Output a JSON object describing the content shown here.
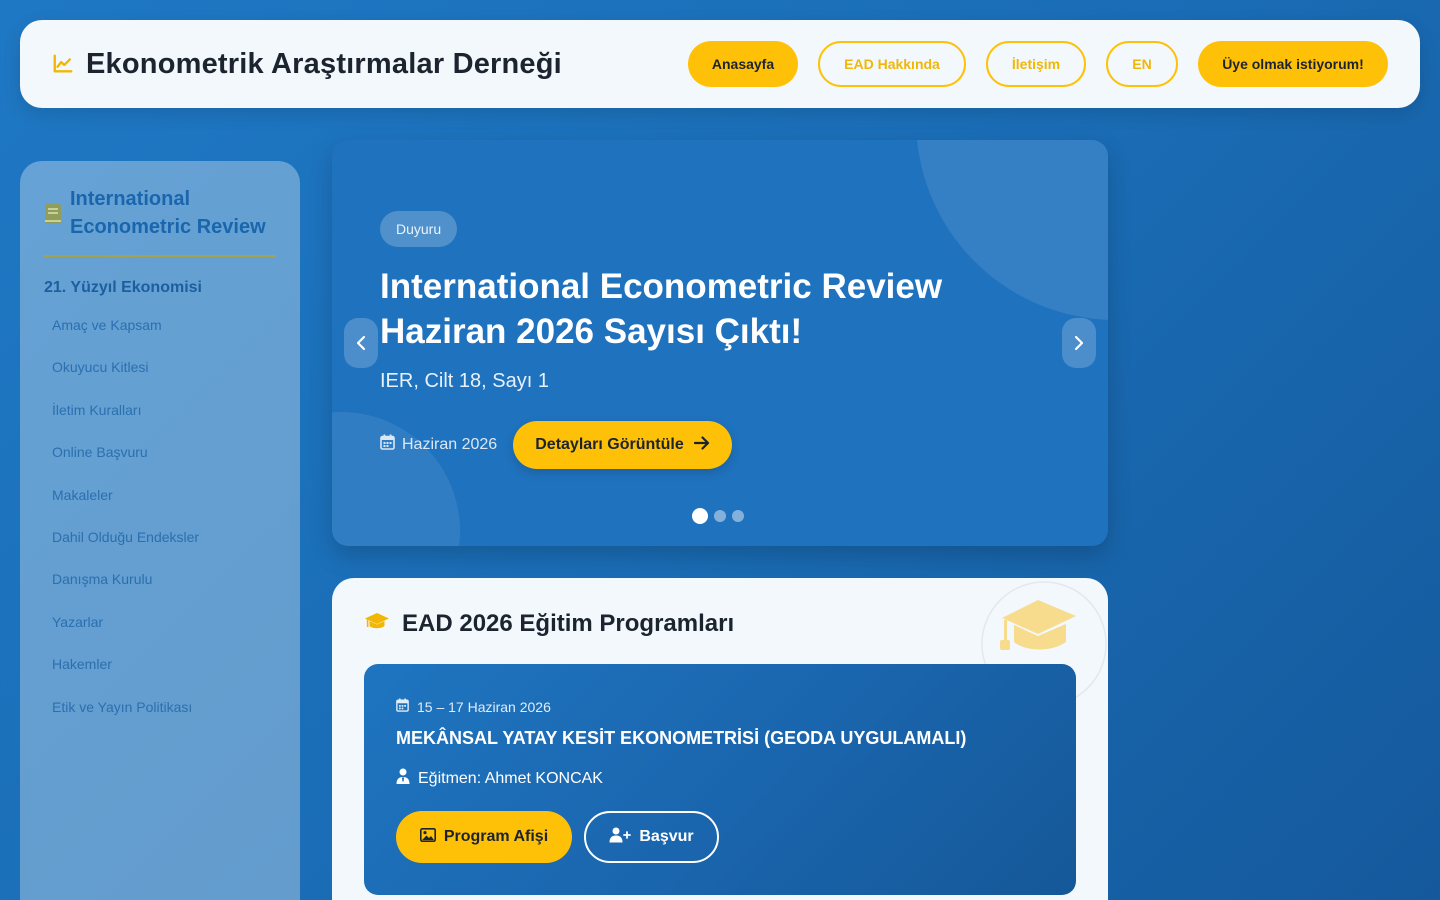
{
  "header": {
    "title": "Ekonometrik Araştırmalar Derneği",
    "brand_icon": "chart-line-icon",
    "nav": {
      "home": "Anasayfa",
      "about": "EAD Hakkında",
      "contact": "İletişim",
      "lang": "EN",
      "join": "Üye olmak istiyorum!"
    }
  },
  "sidebar": {
    "title": "International Econometric Review",
    "section": "21. Yüzyıl Ekonomisi",
    "items": [
      "Amaç ve Kapsam",
      "Okuyucu Kitlesi",
      "İletim Kuralları",
      "Online Başvuru",
      "Makaleler",
      "Dahil Olduğu Endeksler",
      "Danışma Kurulu",
      "Yazarlar",
      "Hakemler",
      "Etik ve Yayın Politikası"
    ]
  },
  "hero": {
    "badge": "Duyuru",
    "title": "International Econometric Review Haziran 2026 Sayısı Çıktı!",
    "subtitle": "IER, Cilt 18, Sayı 1",
    "date": "Haziran 2026",
    "button": "Detayları Görüntüle",
    "slides_total": 3,
    "active_slide": 1
  },
  "programs": {
    "title": "EAD 2026 Eğitim Programları",
    "item": {
      "date": "15 – 17 Haziran 2026",
      "name": "MEKÂNSAL YATAY KESİT EKONOMETRİSİ (GEODA UYGULAMALI)",
      "instructor": "Eğitmen: Ahmet KONCAK",
      "poster_button": "Program Afişi",
      "apply_button": "Başvur"
    }
  },
  "colors": {
    "accent": "#ffc107",
    "primary": "#1f72be",
    "background": "#1a6db6",
    "card": "#f3f8fc"
  }
}
